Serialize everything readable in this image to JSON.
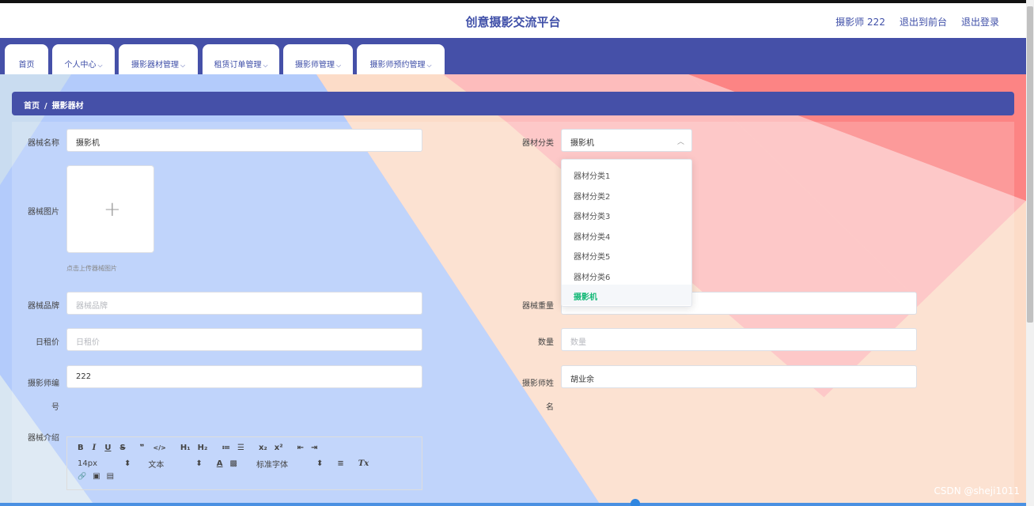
{
  "header": {
    "title": "创意摄影交流平台",
    "user": "摄影师 222",
    "to_front": "退出到前台",
    "logout": "退出登录"
  },
  "nav": {
    "tabs": [
      {
        "label": "首页",
        "has_dropdown": false
      },
      {
        "label": "个人中心",
        "has_dropdown": true
      },
      {
        "label": "摄影器材管理",
        "has_dropdown": true
      },
      {
        "label": "租赁订单管理",
        "has_dropdown": true
      },
      {
        "label": "摄影师管理",
        "has_dropdown": true
      },
      {
        "label": "摄影师预约管理",
        "has_dropdown": true
      }
    ],
    "chevron": "⌵"
  },
  "breadcrumb": {
    "home": "首页",
    "separator": "/",
    "current": "摄影器材"
  },
  "form": {
    "name": {
      "label": "器械名称",
      "value": "摄影机"
    },
    "category": {
      "label": "器材分类",
      "value": "摄影机",
      "options": [
        "器材分类1",
        "器材分类2",
        "器材分类3",
        "器材分类4",
        "器材分类5",
        "器材分类6",
        "摄影机"
      ],
      "selected_index": 6
    },
    "image": {
      "label": "器械图片",
      "hint": "点击上传器械图片"
    },
    "brand": {
      "label": "器械品牌",
      "placeholder": "器械品牌"
    },
    "weight": {
      "label": "器械重量"
    },
    "daily_rent": {
      "label": "日租价",
      "placeholder": "日租价"
    },
    "quantity": {
      "label": "数量",
      "placeholder": "数量"
    },
    "photographer_id": {
      "label_line1": "摄影师编",
      "label_line2": "号",
      "value": "222"
    },
    "photographer_name": {
      "label_line1": "摄影师姓",
      "label_line2": "名",
      "value": "胡业余"
    },
    "intro": {
      "label": "器械介绍"
    }
  },
  "editor": {
    "row1": [
      "B",
      "I",
      "U",
      "S",
      "❞",
      "</>",
      "H₁",
      "H₂",
      "≔",
      "☰",
      "x₂",
      "x²",
      "⇤",
      "⇥"
    ],
    "font_size": "14px",
    "block_format": "文本",
    "font_family": "标准字体",
    "updown": "⬍",
    "row2_icons": [
      "A",
      "▩",
      "≡",
      "Tx"
    ],
    "row3": [
      "🔗",
      "▣",
      "▤"
    ]
  },
  "watermark": "CSDN @sheji1011",
  "colors": {
    "primary": "#4550a8",
    "selected_option": "#17b978",
    "bg_blue": "#b3cbfb",
    "bg_pink": "#fdbcbc",
    "bg_peach": "#fcdcc8"
  }
}
